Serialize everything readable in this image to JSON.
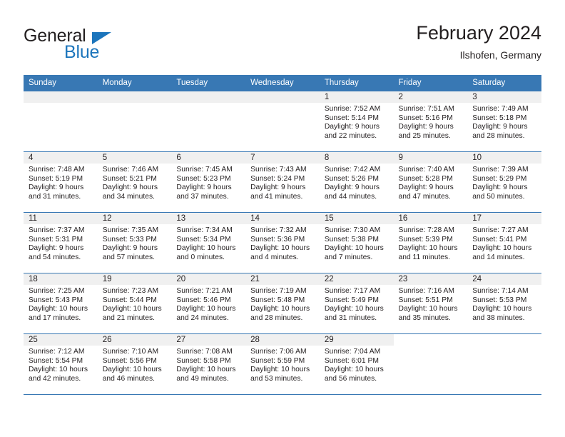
{
  "brand": {
    "name_part1": "General",
    "name_part2": "Blue",
    "accent_color": "#1c75bc"
  },
  "header": {
    "month_title": "February 2024",
    "location": "Ilshofen, Germany"
  },
  "calendar": {
    "header_color": "#3878b4",
    "weekday_headers": [
      "Sunday",
      "Monday",
      "Tuesday",
      "Wednesday",
      "Thursday",
      "Friday",
      "Saturday"
    ],
    "weeks": [
      [
        {
          "day": "",
          "lines": []
        },
        {
          "day": "",
          "lines": []
        },
        {
          "day": "",
          "lines": []
        },
        {
          "day": "",
          "lines": []
        },
        {
          "day": "1",
          "lines": [
            "Sunrise: 7:52 AM",
            "Sunset: 5:14 PM",
            "Daylight: 9 hours",
            "and 22 minutes."
          ]
        },
        {
          "day": "2",
          "lines": [
            "Sunrise: 7:51 AM",
            "Sunset: 5:16 PM",
            "Daylight: 9 hours",
            "and 25 minutes."
          ]
        },
        {
          "day": "3",
          "lines": [
            "Sunrise: 7:49 AM",
            "Sunset: 5:18 PM",
            "Daylight: 9 hours",
            "and 28 minutes."
          ]
        }
      ],
      [
        {
          "day": "4",
          "lines": [
            "Sunrise: 7:48 AM",
            "Sunset: 5:19 PM",
            "Daylight: 9 hours",
            "and 31 minutes."
          ]
        },
        {
          "day": "5",
          "lines": [
            "Sunrise: 7:46 AM",
            "Sunset: 5:21 PM",
            "Daylight: 9 hours",
            "and 34 minutes."
          ]
        },
        {
          "day": "6",
          "lines": [
            "Sunrise: 7:45 AM",
            "Sunset: 5:23 PM",
            "Daylight: 9 hours",
            "and 37 minutes."
          ]
        },
        {
          "day": "7",
          "lines": [
            "Sunrise: 7:43 AM",
            "Sunset: 5:24 PM",
            "Daylight: 9 hours",
            "and 41 minutes."
          ]
        },
        {
          "day": "8",
          "lines": [
            "Sunrise: 7:42 AM",
            "Sunset: 5:26 PM",
            "Daylight: 9 hours",
            "and 44 minutes."
          ]
        },
        {
          "day": "9",
          "lines": [
            "Sunrise: 7:40 AM",
            "Sunset: 5:28 PM",
            "Daylight: 9 hours",
            "and 47 minutes."
          ]
        },
        {
          "day": "10",
          "lines": [
            "Sunrise: 7:39 AM",
            "Sunset: 5:29 PM",
            "Daylight: 9 hours",
            "and 50 minutes."
          ]
        }
      ],
      [
        {
          "day": "11",
          "lines": [
            "Sunrise: 7:37 AM",
            "Sunset: 5:31 PM",
            "Daylight: 9 hours",
            "and 54 minutes."
          ]
        },
        {
          "day": "12",
          "lines": [
            "Sunrise: 7:35 AM",
            "Sunset: 5:33 PM",
            "Daylight: 9 hours",
            "and 57 minutes."
          ]
        },
        {
          "day": "13",
          "lines": [
            "Sunrise: 7:34 AM",
            "Sunset: 5:34 PM",
            "Daylight: 10 hours",
            "and 0 minutes."
          ]
        },
        {
          "day": "14",
          "lines": [
            "Sunrise: 7:32 AM",
            "Sunset: 5:36 PM",
            "Daylight: 10 hours",
            "and 4 minutes."
          ]
        },
        {
          "day": "15",
          "lines": [
            "Sunrise: 7:30 AM",
            "Sunset: 5:38 PM",
            "Daylight: 10 hours",
            "and 7 minutes."
          ]
        },
        {
          "day": "16",
          "lines": [
            "Sunrise: 7:28 AM",
            "Sunset: 5:39 PM",
            "Daylight: 10 hours",
            "and 11 minutes."
          ]
        },
        {
          "day": "17",
          "lines": [
            "Sunrise: 7:27 AM",
            "Sunset: 5:41 PM",
            "Daylight: 10 hours",
            "and 14 minutes."
          ]
        }
      ],
      [
        {
          "day": "18",
          "lines": [
            "Sunrise: 7:25 AM",
            "Sunset: 5:43 PM",
            "Daylight: 10 hours",
            "and 17 minutes."
          ]
        },
        {
          "day": "19",
          "lines": [
            "Sunrise: 7:23 AM",
            "Sunset: 5:44 PM",
            "Daylight: 10 hours",
            "and 21 minutes."
          ]
        },
        {
          "day": "20",
          "lines": [
            "Sunrise: 7:21 AM",
            "Sunset: 5:46 PM",
            "Daylight: 10 hours",
            "and 24 minutes."
          ]
        },
        {
          "day": "21",
          "lines": [
            "Sunrise: 7:19 AM",
            "Sunset: 5:48 PM",
            "Daylight: 10 hours",
            "and 28 minutes."
          ]
        },
        {
          "day": "22",
          "lines": [
            "Sunrise: 7:17 AM",
            "Sunset: 5:49 PM",
            "Daylight: 10 hours",
            "and 31 minutes."
          ]
        },
        {
          "day": "23",
          "lines": [
            "Sunrise: 7:16 AM",
            "Sunset: 5:51 PM",
            "Daylight: 10 hours",
            "and 35 minutes."
          ]
        },
        {
          "day": "24",
          "lines": [
            "Sunrise: 7:14 AM",
            "Sunset: 5:53 PM",
            "Daylight: 10 hours",
            "and 38 minutes."
          ]
        }
      ],
      [
        {
          "day": "25",
          "lines": [
            "Sunrise: 7:12 AM",
            "Sunset: 5:54 PM",
            "Daylight: 10 hours",
            "and 42 minutes."
          ]
        },
        {
          "day": "26",
          "lines": [
            "Sunrise: 7:10 AM",
            "Sunset: 5:56 PM",
            "Daylight: 10 hours",
            "and 46 minutes."
          ]
        },
        {
          "day": "27",
          "lines": [
            "Sunrise: 7:08 AM",
            "Sunset: 5:58 PM",
            "Daylight: 10 hours",
            "and 49 minutes."
          ]
        },
        {
          "day": "28",
          "lines": [
            "Sunrise: 7:06 AM",
            "Sunset: 5:59 PM",
            "Daylight: 10 hours",
            "and 53 minutes."
          ]
        },
        {
          "day": "29",
          "lines": [
            "Sunrise: 7:04 AM",
            "Sunset: 6:01 PM",
            "Daylight: 10 hours",
            "and 56 minutes."
          ]
        },
        {
          "day": "",
          "lines": []
        },
        {
          "day": "",
          "lines": []
        }
      ]
    ]
  }
}
